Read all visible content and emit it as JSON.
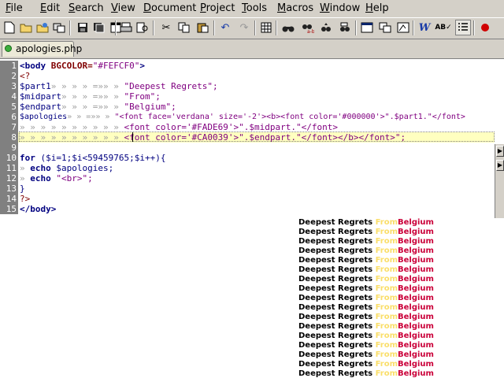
{
  "menu": {
    "items": [
      "File",
      "Edit",
      "Search",
      "View",
      "Document",
      "Project",
      "Tools",
      "Macros",
      "Window",
      "Help"
    ]
  },
  "tabs": [
    {
      "label": "apologies.php",
      "active": true
    }
  ],
  "editor": {
    "current_line": 8,
    "lines": [
      {
        "num": "1"
      },
      {
        "num": "2"
      },
      {
        "num": "3"
      },
      {
        "num": "4"
      },
      {
        "num": "5"
      },
      {
        "num": "6"
      },
      {
        "num": "7"
      },
      {
        "num": "8"
      },
      {
        "num": "9"
      },
      {
        "num": "10"
      },
      {
        "num": "11"
      },
      {
        "num": "12"
      },
      {
        "num": "13"
      },
      {
        "num": "14"
      },
      {
        "num": "15"
      }
    ],
    "code": {
      "l1_tag": "<body",
      "l1_attr": "BGCOLOR=",
      "l1_val": "\"#FEFCF0\"",
      "l1_close": ">",
      "l2": "<?",
      "l3_var": "$part1",
      "l3_tabs": "» » » » =»» »",
      "l3_str": "\"Deepest Regrets\";",
      "l4_var": "$midpart",
      "l4_tabs": "» » » =»» »",
      "l4_str": "\"From\";",
      "l5_var": "$endpart",
      "l5_tabs": "» » » =»» »",
      "l5_str": "\"Belgium\";",
      "l6_var": "$apologies",
      "l6_tabs": "» » =»» »",
      "l6_str": "\"<font face='verdana' size='-2'><b><font color='#000000'>\".$part1.\"</font>",
      "l7_tabs": "» » » » » » » » » »",
      "l7_str": "<font color='#FADE69'>\".$midpart.\"</font>",
      "l8_tabs": "» » » » » » » » » »",
      "l8_str": "<font color='#CA0039'>\".$endpart.\"</font></b></font>\";",
      "l10_kw": "for",
      "l10_rest": "($i=1;$i<59459765;$i++){",
      "l11_tabs": "»",
      "l11_kw": "echo",
      "l11_var": "$apologies;",
      "l12_tabs": "»",
      "l12_kw": "echo",
      "l12_str": "\"<br>\";",
      "l13": "}",
      "l14": "?>",
      "l15": "</body>"
    }
  },
  "output": {
    "part1": "Deepest Regrets",
    "part2": "From",
    "part3": "Belgium",
    "line_count": 17
  },
  "colors": {
    "part1": "#000000",
    "part2": "#FADE69",
    "part3": "#CA0039",
    "gutter": "#808080",
    "chrome": "#d4d0c8"
  }
}
